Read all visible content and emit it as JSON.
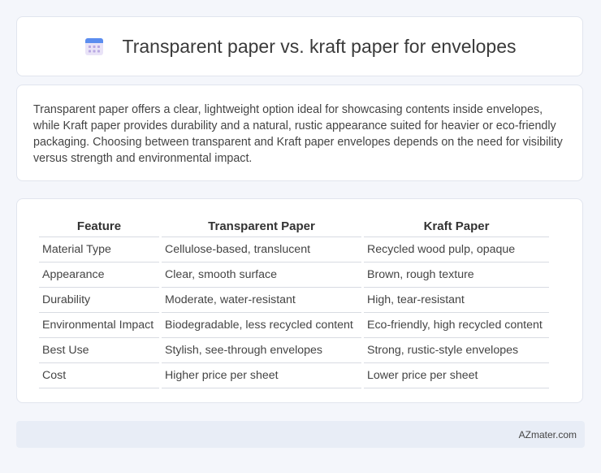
{
  "header": {
    "title": "Transparent paper vs. kraft paper for envelopes",
    "icon": "calendar-icon"
  },
  "intro": {
    "text": "Transparent paper offers a clear, lightweight option ideal for showcasing contents inside envelopes, while Kraft paper provides durability and a natural, rustic appearance suited for heavier or eco-friendly packaging. Choosing between transparent and Kraft paper envelopes depends on the need for visibility versus strength and environmental impact."
  },
  "table": {
    "headers": [
      "Feature",
      "Transparent Paper",
      "Kraft Paper"
    ],
    "rows": [
      [
        "Material Type",
        "Cellulose-based, translucent",
        "Recycled wood pulp, opaque"
      ],
      [
        "Appearance",
        "Clear, smooth surface",
        "Brown, rough texture"
      ],
      [
        "Durability",
        "Moderate, water-resistant",
        "High, tear-resistant"
      ],
      [
        "Environmental Impact",
        "Biodegradable, less recycled content",
        "Eco-friendly, high recycled content"
      ],
      [
        "Best Use",
        "Stylish, see-through envelopes",
        "Strong, rustic-style envelopes"
      ],
      [
        "Cost",
        "Higher price per sheet",
        "Lower price per sheet"
      ]
    ]
  },
  "footer": {
    "brand": "AZmater.com"
  },
  "colors": {
    "background": "#f4f6fb",
    "card": "#ffffff",
    "footer_bg": "#e8edf6",
    "icon_accent": "#5b8def"
  }
}
